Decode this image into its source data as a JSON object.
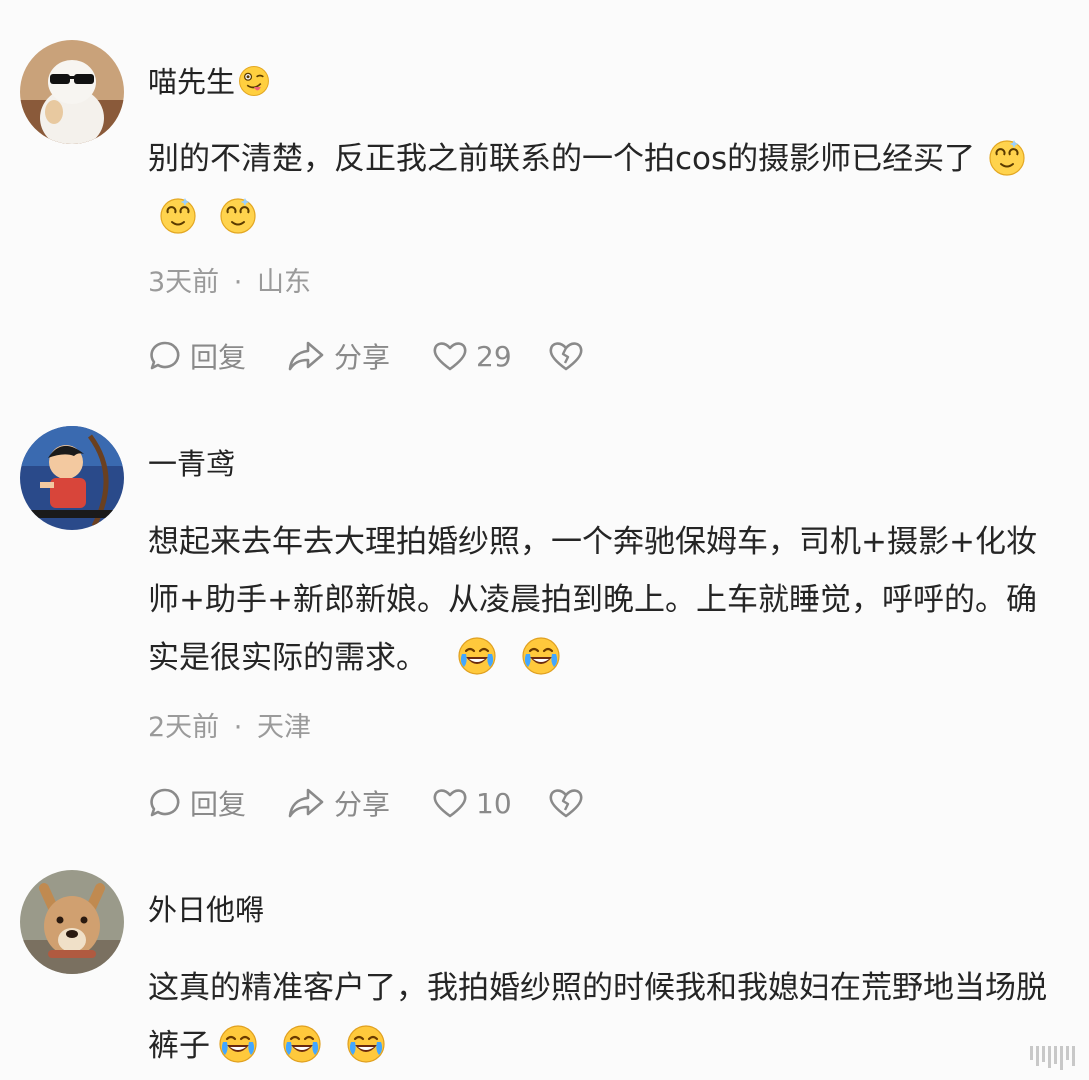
{
  "comments": [
    {
      "username": "喵先生",
      "username_emoji": "goofy-face-emoji",
      "text": "别的不清楚，反正我之前联系的一个拍cos的摄影师已经买了",
      "trailing_emojis": [
        "dizzy-face-emoji",
        "dizzy-face-emoji",
        "dizzy-face-emoji"
      ],
      "time": "3天前",
      "separator": "·",
      "location": "山东",
      "reply_label": "回复",
      "share_label": "分享",
      "like_count": "29"
    },
    {
      "username": "一青鸢",
      "text": "想起来去年去大理拍婚纱照，一个奔驰保姆车，司机+摄影+化妆师+助手+新郎新娘。从凌晨拍到晚上。上车就睡觉，呼呼的。确实是很实际的需求。",
      "trailing_emojis": [
        "laugh-cry-emoji",
        "laugh-cry-emoji"
      ],
      "time": "2天前",
      "separator": "·",
      "location": "天津",
      "reply_label": "回复",
      "share_label": "分享",
      "like_count": "10"
    },
    {
      "username": "外日他嘚",
      "text": "这真的精准客户了，我拍婚纱照的时候我和我媳妇在荒野地当场脱裤子",
      "trailing_emojis": [
        "laugh-cry-emoji",
        "laugh-cry-emoji",
        "laugh-cry-emoji"
      ]
    }
  ],
  "colors": {
    "text": "#252525",
    "muted": "#9a9a9a",
    "icon": "#8a8a8a",
    "background": "#fbfbfb"
  }
}
